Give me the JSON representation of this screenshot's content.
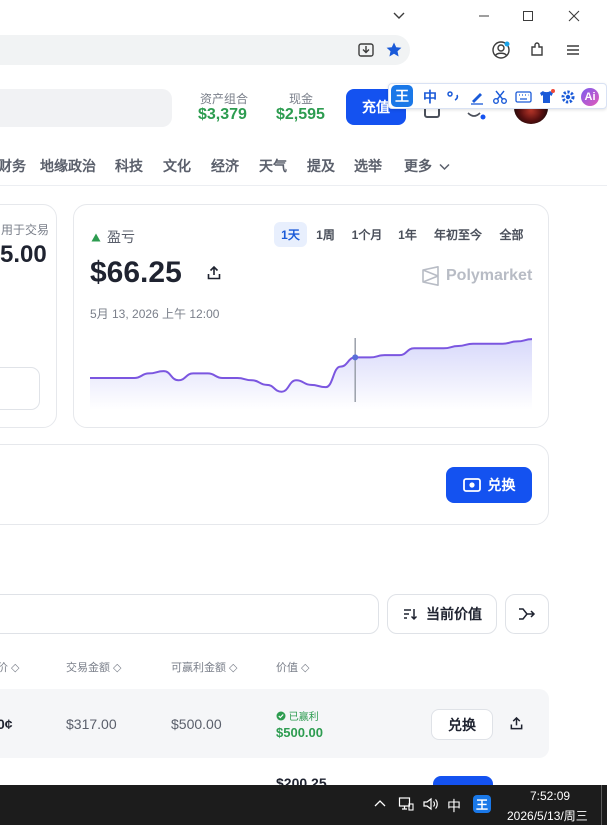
{
  "browser": {
    "window_controls": [
      "chevron-down",
      "minimize",
      "maximize",
      "close"
    ]
  },
  "header": {
    "portfolio_label": "资产组合",
    "portfolio_value": "$3,379",
    "cash_label": "现金",
    "cash_value": "$2,595",
    "deposit_label": "充值"
  },
  "ime": {
    "logo": "王",
    "mode": "中",
    "ai_label": "Ai"
  },
  "nav": {
    "items": [
      "财务",
      "地缘政治",
      "科技",
      "文化",
      "经济",
      "天气",
      "提及",
      "选举"
    ],
    "more_label": "更多"
  },
  "left_card": {
    "label_partial": "用于交易",
    "value_partial": "5.00"
  },
  "pnl_card": {
    "label": "盈亏",
    "value": "$66.25",
    "date": "5月 13, 2026 上午 12:00",
    "brand": "Polymarket",
    "ranges": [
      "1天",
      "1周",
      "1个月",
      "1年",
      "年初至今",
      "全部"
    ],
    "active_range": "1天"
  },
  "chart_data": {
    "type": "area",
    "title": "",
    "xlabel": "",
    "ylabel": "",
    "x": [
      0,
      1,
      2,
      3,
      4,
      5,
      6,
      7,
      8,
      9,
      10,
      11,
      12,
      13,
      14,
      15,
      16,
      17,
      18,
      19,
      20,
      21,
      22,
      23,
      24,
      25,
      26,
      27,
      28,
      29,
      30
    ],
    "series": [
      {
        "name": "",
        "values": [
          54,
          54,
          54,
          54,
          56,
          57,
          53,
          56,
          56,
          54,
          54,
          53,
          51,
          48,
          53,
          51,
          50,
          59,
          63,
          63,
          64,
          64,
          67,
          67,
          67,
          68,
          69,
          69,
          69,
          70,
          71
        ]
      }
    ],
    "highlight_index": 18,
    "ylim": [
      40,
      75
    ],
    "grid": false,
    "line_color": "#7b56e0"
  },
  "exchange_card": {
    "button_label": "兑换"
  },
  "positions": {
    "sort_label": "当前价值",
    "columns": [
      "价",
      "交易金额",
      "可赢利金额",
      "价值"
    ],
    "rows": [
      {
        "avg_partial": "0¢",
        "traded": "$317.00",
        "to_win": "$500.00",
        "status": "已赢利",
        "value": "$500.00",
        "action": "兑换"
      },
      {
        "value_partial": "$200.25"
      }
    ]
  },
  "taskbar": {
    "ime_mode": "中",
    "ime_logo": "王",
    "time": "7:52:09",
    "date": "2026/5/13/周三"
  }
}
